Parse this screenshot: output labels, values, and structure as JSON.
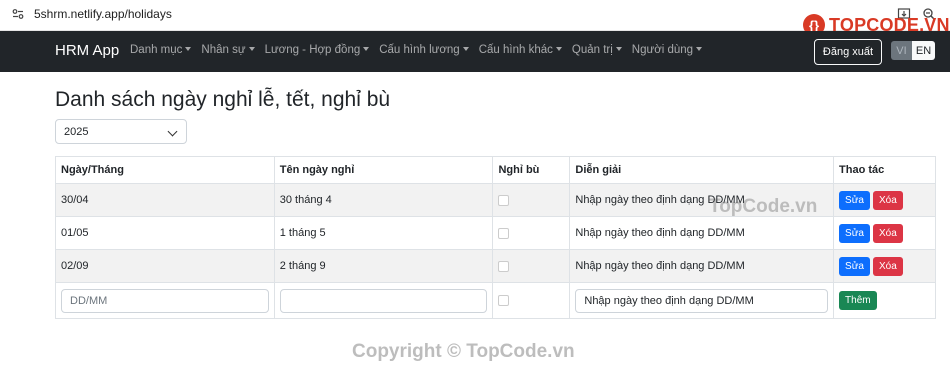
{
  "browser": {
    "url": "5shrm.netlify.app/holidays"
  },
  "logo": {
    "text": "TOPCODE.VN"
  },
  "navbar": {
    "brand": "HRM App",
    "menu": [
      "Danh mục",
      "Nhân sự",
      "Lương - Hợp đồng",
      "Cấu hình lương",
      "Cấu hình khác",
      "Quản trị",
      "Người dùng"
    ],
    "logout": "Đăng xuất",
    "lang_vi": "VI",
    "lang_en": "EN"
  },
  "page": {
    "title": "Danh sách ngày nghỉ lễ, tết, nghỉ bù",
    "year": "2025"
  },
  "table": {
    "headers": [
      "Ngày/Tháng",
      "Tên ngày nghỉ",
      "Nghỉ bù",
      "Diễn giải",
      "Thao tác"
    ],
    "rows": [
      {
        "date": "30/04",
        "name": "30 tháng 4",
        "desc": "Nhập ngày theo định dạng DD/MM"
      },
      {
        "date": "01/05",
        "name": "1 tháng 5",
        "desc": "Nhập ngày theo định dạng DD/MM"
      },
      {
        "date": "02/09",
        "name": "2 tháng 9",
        "desc": "Nhập ngày theo định dạng DD/MM"
      }
    ],
    "edit_label": "Sửa",
    "delete_label": "Xóa",
    "new_row": {
      "date_placeholder": "DD/MM",
      "name_placeholder": "",
      "desc_value": "Nhập ngày theo định dạng DD/MM",
      "add_label": "Thêm"
    }
  },
  "watermarks": {
    "mid": "TopCode.vn",
    "bottom": "Copyright © TopCode.vn"
  }
}
